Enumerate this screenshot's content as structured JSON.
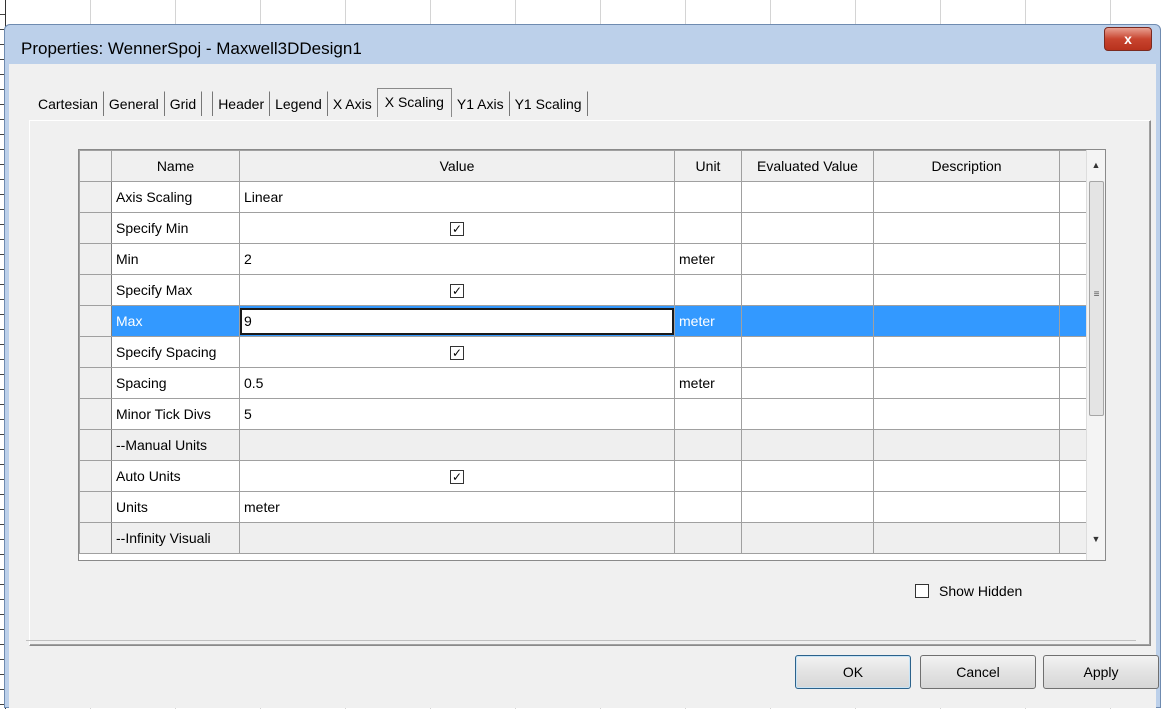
{
  "window": {
    "title": "Properties: WennerSpoj - Maxwell3DDesign1",
    "close_label": "x"
  },
  "tabs": [
    {
      "label": "Cartesian"
    },
    {
      "label": "General"
    },
    {
      "label": "Grid"
    },
    {
      "label": "Header"
    },
    {
      "label": "Legend"
    },
    {
      "label": "X Axis"
    },
    {
      "label": "X Scaling",
      "active": true
    },
    {
      "label": "Y1 Axis"
    },
    {
      "label": "Y1 Scaling"
    }
  ],
  "grid": {
    "columns": [
      "Name",
      "Value",
      "Unit",
      "Evaluated Value",
      "Description"
    ],
    "rows": [
      {
        "name": "Axis Scaling",
        "value": "Linear",
        "unit": "",
        "checkbox": false
      },
      {
        "name": "Specify Min",
        "value": "",
        "unit": "",
        "checkbox": true,
        "checked": true
      },
      {
        "name": "Min",
        "value": "2",
        "unit": "meter",
        "checkbox": false
      },
      {
        "name": "Specify Max",
        "value": "",
        "unit": "",
        "checkbox": true,
        "checked": true
      },
      {
        "name": "Max",
        "value": "9",
        "unit": "meter",
        "checkbox": false,
        "selected": true
      },
      {
        "name": "Specify Spacing",
        "value": "",
        "unit": "",
        "checkbox": true,
        "checked": true
      },
      {
        "name": "Spacing",
        "value": "0.5",
        "unit": "meter",
        "checkbox": false
      },
      {
        "name": "Minor Tick Divs",
        "value": "5",
        "unit": "",
        "checkbox": false
      },
      {
        "name": "--Manual Units",
        "value": "",
        "unit": "",
        "checkbox": false,
        "section": true
      },
      {
        "name": "Auto Units",
        "value": "",
        "unit": "",
        "checkbox": true,
        "checked": true
      },
      {
        "name": "Units",
        "value": "meter",
        "unit": "",
        "checkbox": false
      },
      {
        "name": "--Infinity Visuali",
        "value": "",
        "unit": "",
        "checkbox": false,
        "section": true
      }
    ],
    "checkmark": "✓",
    "scroll_up": "▲",
    "scroll_down": "▼",
    "scroll_grip": "≡"
  },
  "show_hidden": {
    "label": "Show Hidden",
    "checked": false
  },
  "buttons": {
    "ok": "OK",
    "cancel": "Cancel",
    "apply": "Apply"
  },
  "colors": {
    "selection": "#3399ff",
    "title_bar": "#bcd0ea",
    "close_button": "#c8442f"
  }
}
